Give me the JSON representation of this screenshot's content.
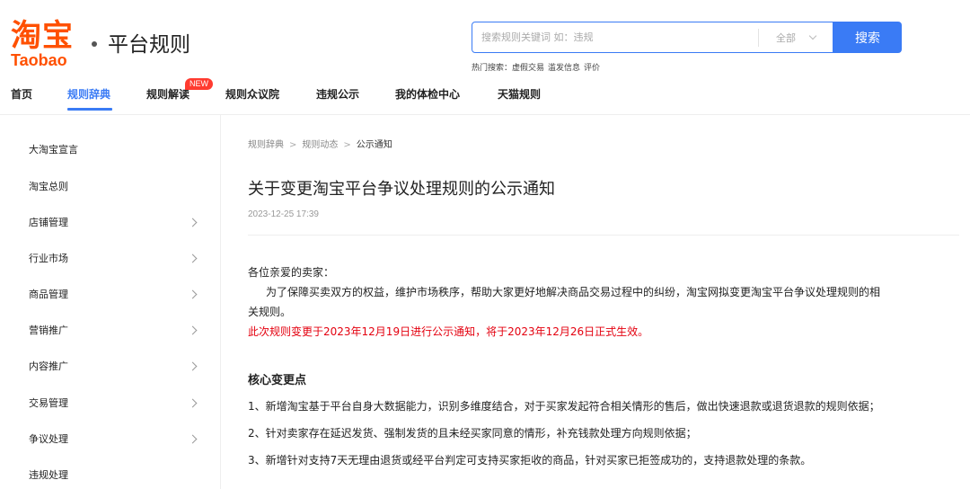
{
  "header": {
    "logo_cn": "淘宝",
    "logo_en": "Taobao",
    "site_title": "平台规则"
  },
  "search": {
    "placeholder": "搜索规则关键词 如：违规",
    "scope": "全部",
    "button": "搜索",
    "hot_label": "热门搜索：",
    "hot_terms": [
      "虚假交易",
      "滥发信息",
      "评价"
    ]
  },
  "nav": {
    "items": [
      "首页",
      "规则辞典",
      "规则解读",
      "规则众议院",
      "违规公示",
      "我的体检中心",
      "天猫规则"
    ],
    "badge": "NEW"
  },
  "sidebar": {
    "items": [
      {
        "label": "大淘宝宣言",
        "expandable": false
      },
      {
        "label": "淘宝总则",
        "expandable": false
      },
      {
        "label": "店铺管理",
        "expandable": true
      },
      {
        "label": "行业市场",
        "expandable": true
      },
      {
        "label": "商品管理",
        "expandable": true
      },
      {
        "label": "营销推广",
        "expandable": true
      },
      {
        "label": "内容推广",
        "expandable": true
      },
      {
        "label": "交易管理",
        "expandable": true
      },
      {
        "label": "争议处理",
        "expandable": true
      },
      {
        "label": "违规处理",
        "expandable": false
      }
    ]
  },
  "breadcrumb": [
    "规则辞典",
    "规则动态",
    "公示通知"
  ],
  "article": {
    "title": "关于变更淘宝平台争议处理规则的公示通知",
    "date": "2023-12-25 17:39",
    "greeting": "各位亲爱的卖家：",
    "intro_line1": "为了保障买卖双方的权益，维护市场秩序，帮助大家更好地解决商品交易过程中的纠纷，淘宝网拟变更淘宝平台争议处理规则的相",
    "intro_line2": "关规则。",
    "notice": "此次规则变更于2023年12月19日进行公示通知，将于2023年12月26日正式生效。",
    "section_title": "核心变更点",
    "changes": [
      "1、新增淘宝基于平台自身大数据能力，识别多维度结合，对于买家发起符合相关情形的售后，做出快速退款或退货退款的规则依据；",
      "2、针对卖家存在延迟发货、强制发货的且未经买家同意的情形，补充钱款处理方向规则依据；",
      "3、新增针对支持7天无理由退货或经平台判定可支持买家拒收的商品，针对买家已拒签成功的，支持退款处理的条款。"
    ]
  },
  "colors": {
    "brand": "#ff5000",
    "accent": "#3a7bf5",
    "alert": "#e4000f"
  }
}
